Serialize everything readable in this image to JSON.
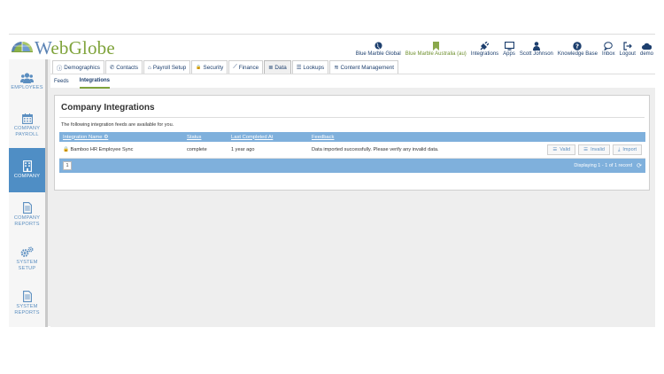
{
  "brand": {
    "logo_text_w": "W",
    "logo_text_rest": "ebGlobe"
  },
  "topnav": [
    {
      "key": "globe",
      "label": "Blue Marble Global",
      "icon": "globe-icon",
      "color": "#1d3f6e"
    },
    {
      "key": "bookmark",
      "label": "Blue Marble Australia (au)",
      "icon": "bookmark-icon",
      "color": "#6e8f2e"
    },
    {
      "key": "integrations",
      "label": "Integrations",
      "icon": "plug-icon",
      "color": "#1d3f6e"
    },
    {
      "key": "apps",
      "label": "Apps",
      "icon": "monitor-icon",
      "color": "#1d3f6e"
    },
    {
      "key": "user",
      "label": "Scott Johnson",
      "icon": "user-icon",
      "color": "#1d3f6e"
    },
    {
      "key": "kb",
      "label": "Knowledge Base",
      "icon": "question-icon",
      "color": "#1d3f6e"
    },
    {
      "key": "inbox",
      "label": "Inbox",
      "icon": "chat-icon",
      "color": "#1d3f6e"
    },
    {
      "key": "logout",
      "label": "Logout",
      "icon": "logout-icon",
      "color": "#1d3f6e"
    },
    {
      "key": "demo",
      "label": "demo",
      "icon": "cloud-icon",
      "color": "#1d3f6e"
    }
  ],
  "sidebar": [
    {
      "line1": "EMPLOYEES",
      "line2": "",
      "icon": "users-icon",
      "active": false
    },
    {
      "line1": "COMPANY",
      "line2": "PAYROLL",
      "icon": "calendar-icon",
      "active": false
    },
    {
      "line1": "COMPANY",
      "line2": "",
      "icon": "building-icon",
      "active": true
    },
    {
      "line1": "COMPANY",
      "line2": "REPORTS",
      "icon": "report-icon",
      "active": false
    },
    {
      "line1": "SYSTEM",
      "line2": "SETUP",
      "icon": "gears-icon",
      "active": false
    },
    {
      "line1": "SYSTEM",
      "line2": "REPORTS",
      "icon": "report-icon",
      "active": false
    }
  ],
  "tabs": [
    {
      "label": "Demographics",
      "glyph": "ⓘ",
      "active": false
    },
    {
      "label": "Contacts",
      "glyph": "✆",
      "active": false
    },
    {
      "label": "Payroll Setup",
      "glyph": "⌂",
      "active": false
    },
    {
      "label": "Security",
      "glyph": "🔒",
      "active": false
    },
    {
      "label": "Finance",
      "glyph": "⟋",
      "active": false
    },
    {
      "label": "Data",
      "glyph": "≣",
      "active": true
    },
    {
      "label": "Lookups",
      "glyph": "☰",
      "active": false
    },
    {
      "label": "Content Management",
      "glyph": "≋",
      "active": false
    }
  ],
  "subtabs": {
    "feeds": "Feeds",
    "integrations": "Integrations"
  },
  "panel": {
    "title": "Company Integrations",
    "description": "The following integration feeds are available for you."
  },
  "grid": {
    "columns": {
      "name": "Integration Name",
      "status": "Status",
      "last": "Last Completed At",
      "feedback": "Feedback"
    },
    "rows": [
      {
        "name": "Bamboo HR Employee Sync",
        "status": "complete",
        "last": "1 year ago",
        "feedback": "Data imported successfully. Please verify any invalid data."
      }
    ],
    "buttons": {
      "valid": "Valid",
      "invalid": "Invalid",
      "import": "Import"
    },
    "page": "1",
    "display": "Displaying 1 - 1 of 1 record"
  }
}
